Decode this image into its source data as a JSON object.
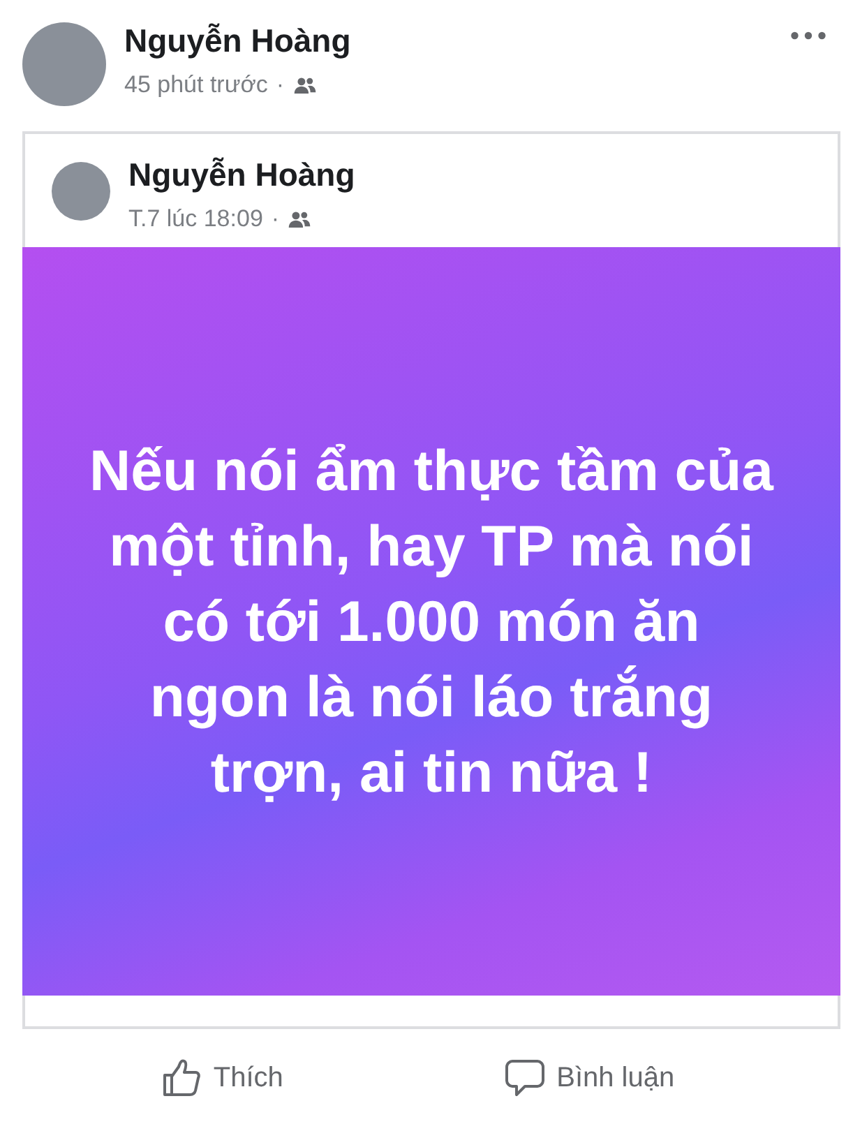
{
  "post": {
    "author": "Nguyễn Hoàng",
    "time": "45 phút trước",
    "separator": "·"
  },
  "shared_post": {
    "author": "Nguyễn Hoàng",
    "time": "T.7 lúc 18:09",
    "separator": "·",
    "text": "Nếu nói ẩm thực tầm của một tỉnh, hay TP mà nói có tới 1.000 món ăn ngon là nói láo trắng trợn, ai tin nữa !"
  },
  "actions": [
    {
      "kind": "like",
      "label": "Thích"
    },
    {
      "kind": "comment",
      "label": "Bình luận"
    }
  ]
}
